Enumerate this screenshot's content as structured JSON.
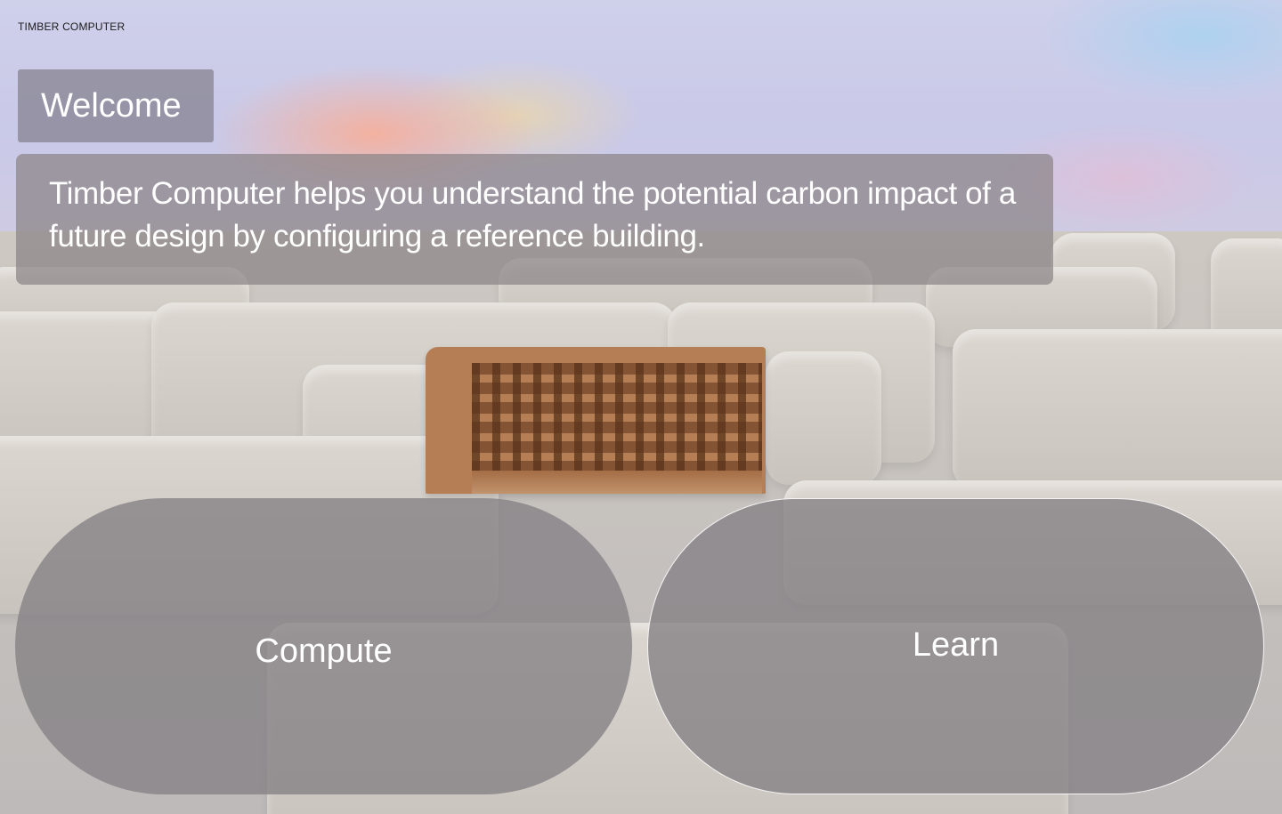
{
  "app": {
    "brand": "TIMBER COMPUTER"
  },
  "welcome": {
    "title": "Welcome"
  },
  "intro": {
    "text": "Timber Computer helps you understand the potential carbon impact of a future design by configuring a reference building."
  },
  "actions": {
    "compute_label": "Compute",
    "learn_label": "Learn"
  },
  "colors": {
    "panel": "#8a8486",
    "text": "#ffffff",
    "timber": "#b57e55"
  }
}
